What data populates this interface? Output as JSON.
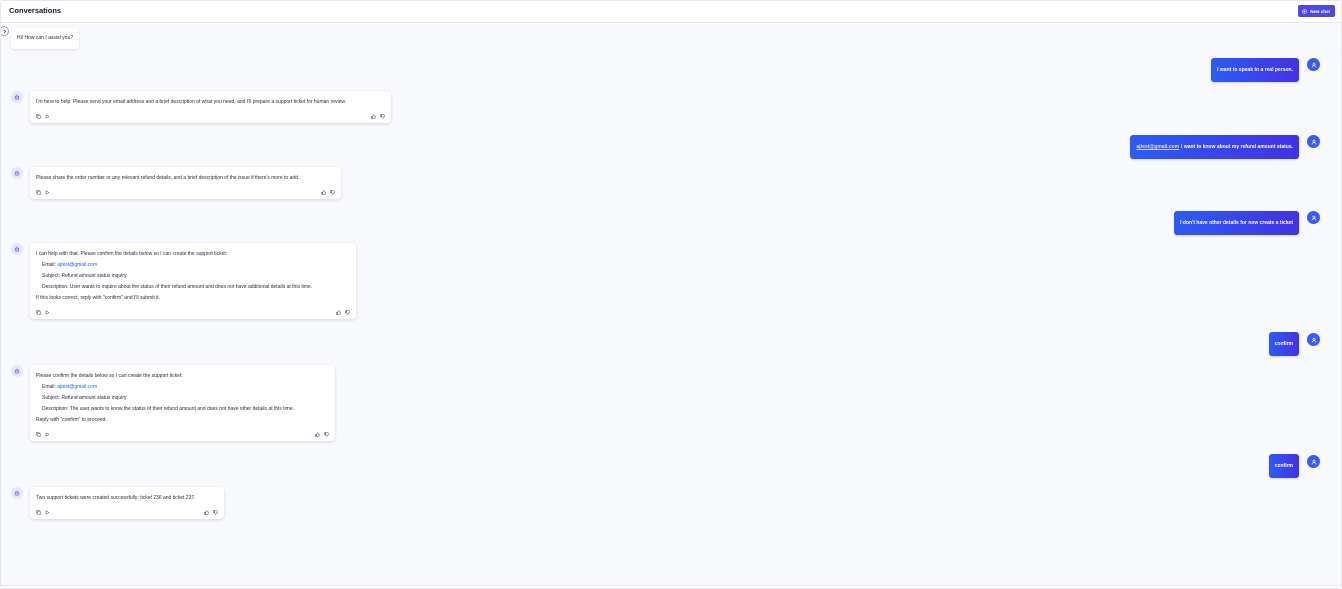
{
  "header": {
    "title": "Conversations",
    "new_chat_label": "New chat"
  },
  "greeting": "Hi! How can I assist you?",
  "user_messages": [
    {
      "text": "I want to speak to a real person."
    },
    {
      "link": "ajtest@gmail.com",
      "text": "I want to know about my refund amount status."
    },
    {
      "text": "I don't have other details for now create a ticket"
    },
    {
      "text": "confirm"
    },
    {
      "text": "confirm"
    }
  ],
  "bot_messages": [
    {
      "lines": [
        "I'm here to help. Please send your email address and a brief description of what you need, and I'll prepare a support ticket for human review."
      ]
    },
    {
      "lines": [
        "Please share the order number or any relevant refund details, and a brief description of the issue if there's more to add."
      ]
    },
    {
      "intro": "I can help with that. Please confirm the details below so I can create the support ticket:",
      "email_label": "Email:",
      "email": "ajtest@gmail.com",
      "subject": "Subject: Refund amount status inquiry",
      "description": "Description: User wants to inquire about the status of their refund amount and does not have additional details at this time.",
      "outro": "If this looks correct, reply with \"confirm\" and I'll submit it."
    },
    {
      "intro": "Please confirm the details below so I can create the support ticket:",
      "email_label": "Email:",
      "email": "ajtest@gmail.com",
      "subject": "Subject: Refund amount status inquiry",
      "description": "Description: The user wants to know the status of their refund amount and does not have other details at this time.",
      "outro": "Reply with \"confirm\" to proceed."
    },
    {
      "lines": [
        "Two support tickets were created successfully: ticket 236 and ticket 237."
      ]
    }
  ],
  "colors": {
    "accent": "#4f46e5",
    "user_bubble_start": "#2d5bf5",
    "user_bubble_end": "#4331e6",
    "link": "#2563eb"
  },
  "icons": [
    "plus-circle-icon",
    "chevron-right-icon",
    "bot-icon",
    "user-icon",
    "copy-icon",
    "play-icon",
    "thumbs-up-icon",
    "thumbs-down-icon"
  ]
}
